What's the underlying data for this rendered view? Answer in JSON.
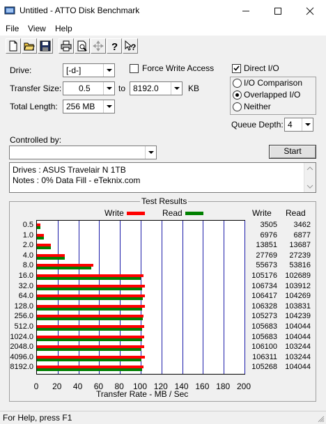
{
  "window": {
    "title": "Untitled - ATTO Disk Benchmark",
    "minimize_icon": "minimize-icon",
    "maximize_icon": "maximize-icon",
    "close_icon": "close-icon"
  },
  "menu": [
    "File",
    "View",
    "Help"
  ],
  "toolbar": [
    "new-icon",
    "open-icon",
    "save-icon",
    "print-icon",
    "print-preview-icon",
    "move-icon",
    "help-icon",
    "context-help-icon"
  ],
  "form": {
    "drive_label": "Drive:",
    "drive_value": "[-d-]",
    "transfer_label": "Transfer Size:",
    "transfer_from": "0.5",
    "to_label": "to",
    "transfer_to": "8192.0",
    "kb_label": "KB",
    "total_label": "Total Length:",
    "total_value": "256 MB",
    "force_write": "Force Write Access",
    "force_write_checked": false,
    "direct_io": "Direct I/O",
    "direct_io_checked": true,
    "io_comparison": "I/O Comparison",
    "overlapped_io": "Overlapped I/O",
    "neither": "Neither",
    "selected_mode": "overlapped",
    "queue_label": "Queue Depth:",
    "queue_value": "4",
    "controlled_label": "Controlled by:",
    "controlled_value": "",
    "start": "Start"
  },
  "notes": {
    "line1": "Drives : ASUS Travelair N 1TB",
    "line2": "Notes : 0% Data Fill - eTeknix.com"
  },
  "results": {
    "title": "Test Results",
    "legend_write": "Write",
    "legend_read": "Read",
    "col_write": "Write",
    "col_read": "Read",
    "xlabel": "Transfer Rate - MB / Sec",
    "write_color": "#ff0000",
    "read_color": "#008000"
  },
  "chart_data": {
    "type": "bar",
    "orientation": "horizontal",
    "title": "Test Results",
    "xlabel": "Transfer Rate - MB / Sec",
    "xlim": [
      0,
      200
    ],
    "x_ticks": [
      "0",
      "20",
      "40",
      "60",
      "80",
      "100",
      "120",
      "140",
      "160",
      "180",
      "200"
    ],
    "categories": [
      "0.5",
      "1.0",
      "2.0",
      "4.0",
      "8.0",
      "16.0",
      "32.0",
      "64.0",
      "128.0",
      "256.0",
      "512.0",
      "1024.0",
      "2048.0",
      "4096.0",
      "8192.0"
    ],
    "series": [
      {
        "name": "Write",
        "color": "#ff0000",
        "values": [
          3505,
          6976,
          13851,
          27769,
          55673,
          105176,
          106734,
          106417,
          106328,
          105273,
          105683,
          105683,
          106100,
          106311,
          105268
        ]
      },
      {
        "name": "Read",
        "color": "#008000",
        "values": [
          3462,
          6877,
          13687,
          27239,
          53816,
          102689,
          103912,
          104269,
          103831,
          104239,
          104044,
          104044,
          103244,
          103244,
          104044
        ]
      }
    ]
  },
  "status": "For Help, press F1"
}
